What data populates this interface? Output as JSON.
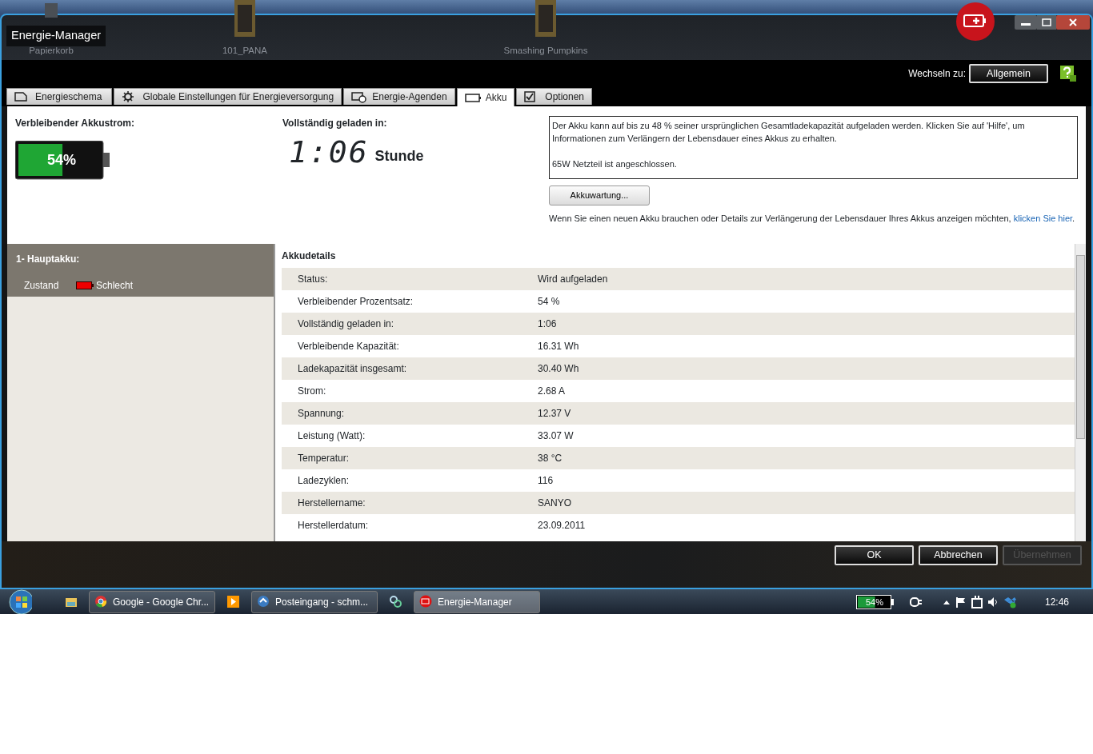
{
  "desktop_icons": [
    {
      "label": "Papierkorb",
      "kind": "bin"
    },
    {
      "label": "101_PANA",
      "kind": "folder"
    },
    {
      "label": "Smashing Pumpkins",
      "kind": "folder"
    }
  ],
  "window": {
    "title": "Energie-Manager"
  },
  "switch": {
    "label": "Wechseln zu:",
    "button": "Allgemein"
  },
  "tabs": [
    {
      "label": "Energieschema",
      "selected": false
    },
    {
      "label": "Globale Einstellungen für Energieversorgung",
      "selected": false
    },
    {
      "label": "Energie-Agenden",
      "selected": false
    },
    {
      "label": "Akku",
      "selected": true
    },
    {
      "label": "Optionen",
      "selected": false
    }
  ],
  "battery_summary": {
    "heading": "Verbleibender Akkustrom:",
    "percent": "54%",
    "level": 0.54
  },
  "full_charge": {
    "heading": "Vollständig geladen in:",
    "time": "1:06",
    "unit": "Stunde"
  },
  "info_box": {
    "lines": [
      "Der Akku kann auf bis zu 48 % seiner ursprünglichen Gesamtladekapazität aufgeladen werden. Klicken Sie auf 'Hilfe', um Informationen zum Verlängern der Lebensdauer eines Akkus zu erhalten.",
      "65W Netzteil ist angeschlossen."
    ]
  },
  "maintenance_button": "Akkuwartung...",
  "replace_note": {
    "text": "Wenn Sie einen neuen Akku brauchen oder Details zur Verlängerung der Lebensdauer Ihres Akkus anzeigen möchten,",
    "link": "klicken Sie hier",
    "after": "."
  },
  "battery_list": [
    {
      "title": "1- Hauptakku:",
      "state_label": "Zustand",
      "state": "Schlecht",
      "selected": true
    }
  ],
  "details": {
    "title": "Akkudetails",
    "rows": [
      {
        "label": "Status:",
        "value": "Wird aufgeladen"
      },
      {
        "label": "Verbleibender Prozentsatz:",
        "value": "54 %"
      },
      {
        "label": "Vollständig geladen in:",
        "value": "1:06"
      },
      {
        "label": "Verbleibende Kapazität:",
        "value": "16.31 Wh"
      },
      {
        "label": "Ladekapazität insgesamt:",
        "value": "30.40 Wh"
      },
      {
        "label": "Strom:",
        "value": "2.68 A"
      },
      {
        "label": "Spannung:",
        "value": "12.37 V"
      },
      {
        "label": "Leistung (Watt):",
        "value": "33.07 W"
      },
      {
        "label": "Temperatur:",
        "value": "38 °C"
      },
      {
        "label": "Ladezyklen:",
        "value": "116"
      },
      {
        "label": "Herstellername:",
        "value": "SANYO"
      },
      {
        "label": "Herstellerdatum:",
        "value": "23.09.2011"
      }
    ]
  },
  "buttons": [
    {
      "label": "OK",
      "disabled": false
    },
    {
      "label": "Abbrechen",
      "disabled": false
    },
    {
      "label": "Übernehmen",
      "disabled": true
    }
  ],
  "taskbar": {
    "items": [
      {
        "kind": "icon"
      },
      {
        "kind": "button",
        "label": "Google - Google Chr...",
        "active": false
      },
      {
        "kind": "icon"
      },
      {
        "kind": "button",
        "label": "Posteingang - schm...",
        "active": false
      },
      {
        "kind": "icon"
      },
      {
        "kind": "button",
        "label": "Energie-Manager",
        "active": true
      }
    ],
    "tray_battery": {
      "percent": "54%",
      "level": 0.54
    },
    "clock": "12:46"
  }
}
